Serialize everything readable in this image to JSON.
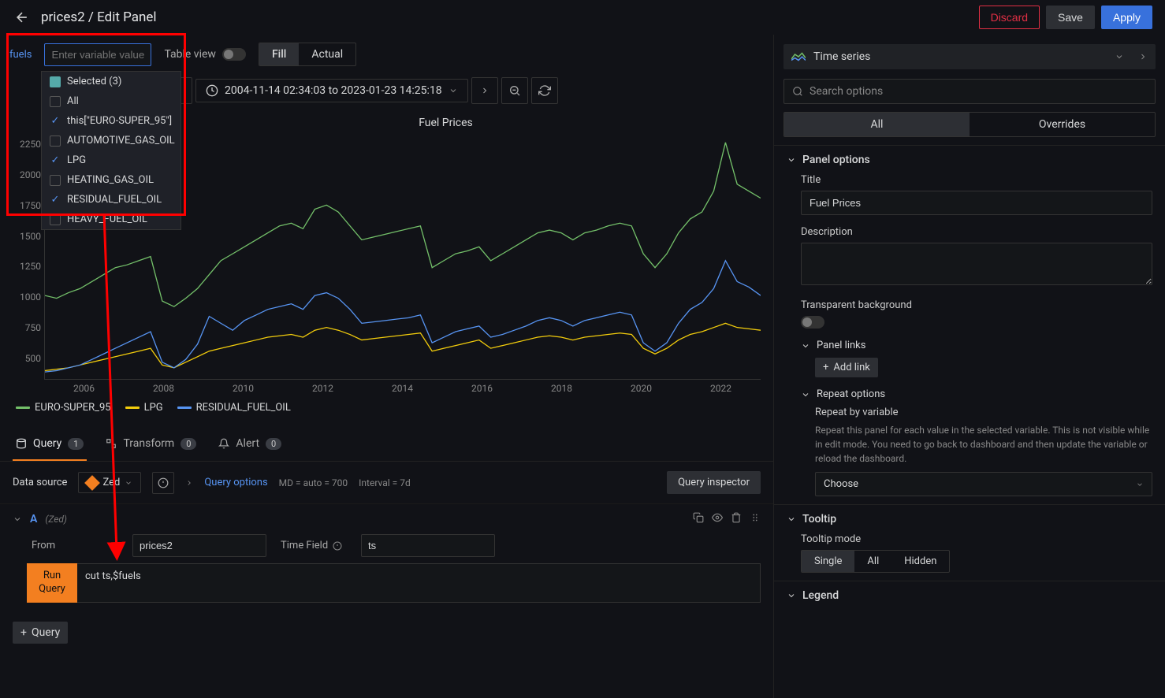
{
  "header": {
    "title": "prices2 / Edit Panel",
    "discard": "Discard",
    "save": "Save",
    "apply": "Apply"
  },
  "toolbar": {
    "var_label": "fuels",
    "var_placeholder": "Enter variable value",
    "table_view": "Table view",
    "fill": "Fill",
    "actual": "Actual"
  },
  "dropdown": {
    "selected_label": "Selected (3)",
    "items": [
      {
        "label": "All",
        "checked": false
      },
      {
        "label": "this[\"EURO-SUPER_95\"]",
        "checked": true
      },
      {
        "label": "AUTOMOTIVE_GAS_OIL",
        "checked": false
      },
      {
        "label": "LPG",
        "checked": true
      },
      {
        "label": "HEATING_GAS_OIL",
        "checked": false
      },
      {
        "label": "RESIDUAL_FUEL_OIL",
        "checked": true
      },
      {
        "label": "HEAVY_FUEL_OIL",
        "checked": false
      }
    ]
  },
  "timerange": {
    "label": "2004-11-14 02:34:03 to 2023-01-23 14:25:18"
  },
  "chart_data": {
    "type": "line",
    "title": "Fuel Prices",
    "ylabel": "",
    "xlabel": "",
    "ylim": [
      500,
      2250
    ],
    "y_ticks": [
      "2250",
      "2000",
      "1750",
      "1500",
      "1250",
      "1000",
      "750",
      "500"
    ],
    "x_ticks": [
      "2006",
      "2008",
      "2010",
      "2012",
      "2014",
      "2016",
      "2018",
      "2020",
      "2022"
    ],
    "series": [
      {
        "name": "EURO-SUPER_95",
        "color": "#73bf69",
        "values": [
          1100,
          1080,
          1120,
          1150,
          1200,
          1250,
          1300,
          1320,
          1350,
          1380,
          1060,
          1020,
          1080,
          1150,
          1250,
          1350,
          1400,
          1450,
          1500,
          1550,
          1600,
          1620,
          1580,
          1720,
          1750,
          1700,
          1600,
          1500,
          1520,
          1540,
          1560,
          1580,
          1600,
          1300,
          1350,
          1400,
          1420,
          1450,
          1350,
          1400,
          1450,
          1500,
          1550,
          1570,
          1550,
          1500,
          1550,
          1570,
          1600,
          1620,
          1600,
          1400,
          1300,
          1400,
          1550,
          1650,
          1700,
          1850,
          2200,
          1900,
          1850,
          1800
        ]
      },
      {
        "name": "LPG",
        "color": "#f2cc0c",
        "values": [
          560,
          570,
          580,
          600,
          620,
          640,
          660,
          680,
          700,
          720,
          600,
          580,
          620,
          660,
          700,
          720,
          740,
          760,
          780,
          800,
          810,
          820,
          800,
          850,
          870,
          850,
          820,
          780,
          790,
          800,
          810,
          820,
          830,
          700,
          720,
          740,
          760,
          780,
          720,
          740,
          760,
          780,
          800,
          810,
          800,
          780,
          800,
          810,
          820,
          830,
          820,
          720,
          680,
          720,
          780,
          820,
          840,
          870,
          900,
          870,
          860,
          850
        ]
      },
      {
        "name": "RESIDUAL_FUEL_OIL",
        "color": "#5794f2",
        "values": [
          550,
          560,
          580,
          600,
          640,
          680,
          720,
          760,
          800,
          840,
          620,
          580,
          640,
          750,
          950,
          900,
          850,
          920,
          960,
          1000,
          1020,
          1040,
          1000,
          1100,
          1120,
          1080,
          1000,
          900,
          910,
          920,
          930,
          940,
          960,
          760,
          800,
          840,
          860,
          880,
          800,
          820,
          850,
          880,
          920,
          940,
          920,
          880,
          920,
          940,
          960,
          980,
          960,
          760,
          700,
          760,
          900,
          1000,
          1050,
          1150,
          1350,
          1200,
          1160,
          1100
        ]
      }
    ],
    "legend": [
      {
        "name": "EURO-SUPER_95",
        "color": "#73bf69"
      },
      {
        "name": "LPG",
        "color": "#f2cc0c"
      },
      {
        "name": "RESIDUAL_FUEL_OIL",
        "color": "#5794f2"
      }
    ]
  },
  "tabs": {
    "query": "Query",
    "query_count": "1",
    "transform": "Transform",
    "transform_count": "0",
    "alert": "Alert",
    "alert_count": "0"
  },
  "datasource": {
    "label": "Data source",
    "name": "Zed",
    "query_options": "Query options",
    "md": "MD = auto = 700",
    "interval": "Interval = 7d",
    "inspector": "Query inspector"
  },
  "query": {
    "letter": "A",
    "ds_name": "(Zed)",
    "from_label": "From",
    "from_value": "prices2",
    "timefield_label": "Time Field",
    "timefield_value": "ts",
    "run": "Run Query",
    "body": "cut ts,$fuels",
    "add": "Query"
  },
  "viz": {
    "name": "Time series"
  },
  "options": {
    "search_placeholder": "Search options",
    "all": "All",
    "overrides": "Overrides",
    "panel_options": "Panel options",
    "title_label": "Title",
    "title_value": "Fuel Prices",
    "description_label": "Description",
    "transparent_label": "Transparent background",
    "panel_links": "Panel links",
    "add_link": "Add link",
    "repeat_options": "Repeat options",
    "repeat_by_var": "Repeat by variable",
    "repeat_desc": "Repeat this panel for each value in the selected variable. This is not visible while in edit mode. You need to go back to dashboard and then update the variable or reload the dashboard.",
    "choose": "Choose",
    "tooltip": "Tooltip",
    "tooltip_mode": "Tooltip mode",
    "single": "Single",
    "tooltip_all": "All",
    "hidden": "Hidden",
    "legend": "Legend"
  }
}
